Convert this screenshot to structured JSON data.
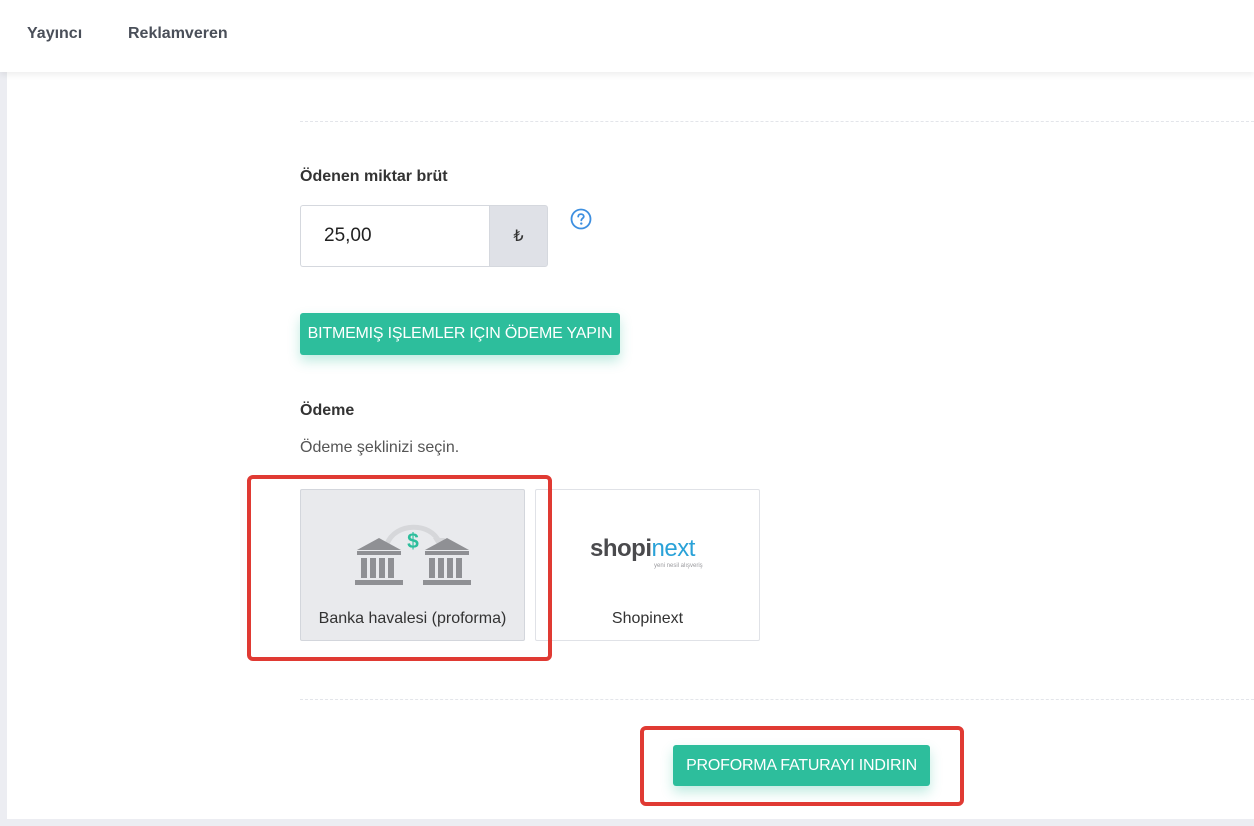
{
  "nav": {
    "items": [
      {
        "label": "Yayıncı"
      },
      {
        "label": "Reklamveren"
      }
    ]
  },
  "amount": {
    "label": "Ödenen miktar brüt",
    "value": "25,00",
    "currency": "₺",
    "help_icon": "question-circle-icon"
  },
  "pay_button": {
    "label": "BITMEMIŞ IŞLEMLER IÇIN ÖDEME YAPIN"
  },
  "payment": {
    "title": "Ödeme",
    "description": "Ödeme şeklinizi seçin.",
    "methods": [
      {
        "label": "Banka havalesi (proforma)",
        "icon": "bank-transfer-icon",
        "selected": true
      },
      {
        "label": "Shopinext",
        "icon": "shopinext-logo",
        "logo_word1": "shopi",
        "logo_word2": "next",
        "logo_tagline": "yeni nesil alışveriş",
        "selected": false
      }
    ]
  },
  "proforma_button": {
    "label": "PROFORMA FATURAYI INDIRIN"
  },
  "colors": {
    "accent": "#2dbe9c",
    "highlight": "#e03a33",
    "help_icon": "#3d8fe0"
  }
}
